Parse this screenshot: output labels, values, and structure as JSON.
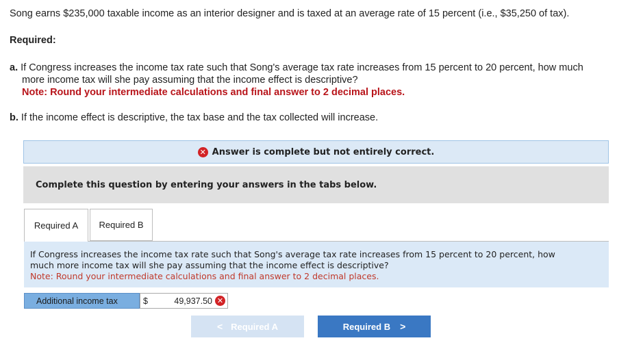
{
  "question": {
    "intro": "Song earns $235,000 taxable income as an interior designer and is taxed at an average rate of 15 percent (i.e., $35,250 of tax).",
    "required_heading": "Required:",
    "part_a": {
      "letter": "a.",
      "text_line1": "If Congress increases the income tax rate such that Song's average tax rate increases from 15 percent to 20 percent, how much",
      "text_line2": "more income tax will she pay assuming that the income effect is descriptive?",
      "note": "Note: Round your intermediate calculations and final answer to 2 decimal places."
    },
    "part_b": {
      "letter": "b.",
      "text": "If the income effect is descriptive, the tax base and the tax collected will increase."
    }
  },
  "status": {
    "icon": "x-circle-icon",
    "text": "Answer is complete but not entirely correct.",
    "color": "#d22326"
  },
  "instruction": "Complete this question by entering your answers in the tabs below.",
  "tabs": [
    {
      "label": "Required A",
      "active": true
    },
    {
      "label": "Required B",
      "active": false
    }
  ],
  "panel": {
    "text_line1": "If Congress increases the income tax rate such that Song's average tax rate increases from 15 percent to 20 percent, how",
    "text_line2": "much more income tax will she pay assuming that the income effect is descriptive?",
    "note": "Note: Round your intermediate calculations and final answer to 2 decimal places."
  },
  "answer": {
    "label": "Additional income tax",
    "currency": "$",
    "value": "49,937.50",
    "status_icon": "x-circle-icon"
  },
  "navigation": {
    "prev_label": "Required A",
    "prev_chevron": "<",
    "next_label": "Required B",
    "next_chevron": ">"
  },
  "colors": {
    "accent": "#3a78c3",
    "error": "#d22326",
    "note_red": "#b8141a"
  }
}
